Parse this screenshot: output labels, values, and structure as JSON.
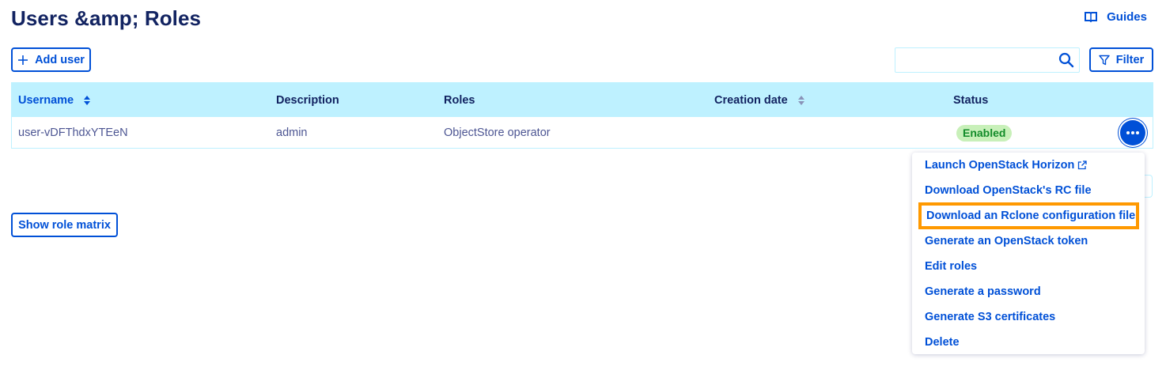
{
  "header": {
    "title": "Users &amp; Roles",
    "guides_label": "Guides"
  },
  "toolbar": {
    "add_user_label": "Add user",
    "search_value": "",
    "filter_label": "Filter"
  },
  "table": {
    "columns": [
      "Username",
      "Description",
      "Roles",
      "Creation date",
      "Status"
    ],
    "rows": [
      {
        "username": "user-vDFThdxYTEeN",
        "description": "admin",
        "roles": "ObjectStore operator",
        "creation_date": "",
        "status": "Enabled"
      }
    ]
  },
  "footer": {
    "show_role_matrix_label": "Show role matrix"
  },
  "action_menu": {
    "items": [
      "Launch OpenStack Horizon",
      "Download OpenStack's RC file",
      "Download an Rclone configuration file",
      "Generate an OpenStack token",
      "Edit roles",
      "Generate a password",
      "Generate S3 certificates",
      "Delete"
    ],
    "highlighted_index": 2
  },
  "colors": {
    "primary": "#0050d7",
    "title": "#122361",
    "header_bg": "#bef1ff",
    "text": "#4d5693",
    "badge_bg": "#c8f0b9",
    "badge_text": "#128b29",
    "highlight_border": "#ff9900"
  },
  "icons": {
    "guides": "book-icon",
    "add": "plus-icon",
    "search": "search-icon",
    "filter": "filter-icon",
    "sort": "sort-icon",
    "menu": "ellipsis-icon",
    "external": "external-link-icon"
  }
}
